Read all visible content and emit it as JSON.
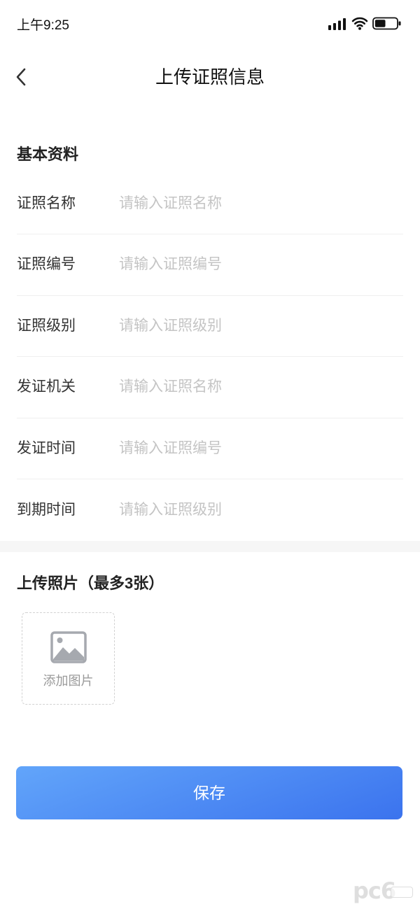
{
  "status_bar": {
    "time": "上午9:25",
    "signal_bars": 4,
    "battery_level": 0.5,
    "icons": [
      "signal-icon",
      "wifi-icon",
      "battery-icon"
    ]
  },
  "nav": {
    "back_icon": "chevron-left-icon",
    "title": "上传证照信息"
  },
  "basic_info": {
    "heading": "基本资料",
    "fields": [
      {
        "label": "证照名称",
        "placeholder": "请输入证照名称",
        "value": ""
      },
      {
        "label": "证照编号",
        "placeholder": "请输入证照编号",
        "value": ""
      },
      {
        "label": "证照级别",
        "placeholder": "请输入证照级别",
        "value": ""
      },
      {
        "label": "发证机关",
        "placeholder": "请输入证照名称",
        "value": ""
      },
      {
        "label": "发证时间",
        "placeholder": "请输入证照编号",
        "value": ""
      },
      {
        "label": "到期时间",
        "placeholder": "请输入证照级别",
        "value": ""
      }
    ]
  },
  "upload": {
    "heading": "上传照片（最多3张）",
    "add_icon": "image-icon",
    "add_label": "添加图片"
  },
  "save_button": {
    "label": "保存"
  },
  "watermark": {
    "text": "pc6"
  },
  "colors": {
    "accent_start": "#62a5fa",
    "accent_end": "#3b73ee",
    "placeholder": "#c4c4c4",
    "icon_gray": "#a6a9af",
    "divider": "#efefef",
    "section_gap": "#f6f6f6"
  }
}
